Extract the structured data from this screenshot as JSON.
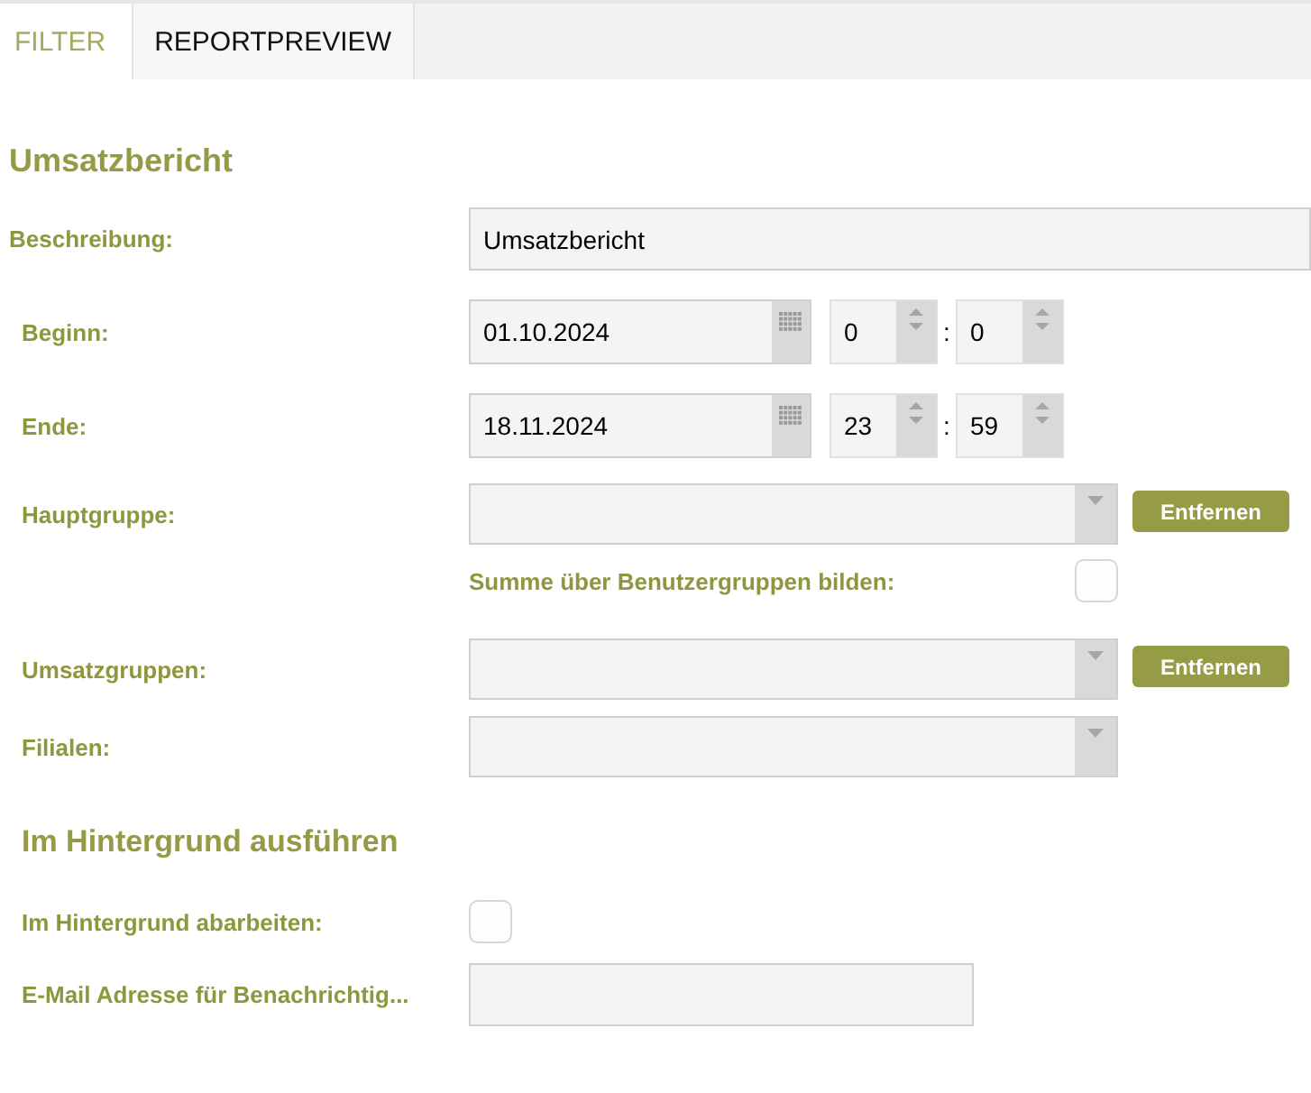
{
  "tabs": [
    {
      "label": "FILTER",
      "selected": true
    },
    {
      "label": "REPORTPREVIEW",
      "selected": false
    }
  ],
  "title": "Umsatzbericht",
  "description": {
    "label": "Beschreibung:",
    "value": "Umsatzbericht"
  },
  "periods": [
    {
      "label": "Beginn:",
      "date": "01.10.2024",
      "hour": "0",
      "minute": "0"
    },
    {
      "label": "Ende:",
      "date": "18.11.2024",
      "hour": "23",
      "minute": "59"
    }
  ],
  "time_separator": ":",
  "groups": [
    {
      "kind": "select",
      "label": "Hauptgruppe:",
      "button": "Entfernen"
    },
    {
      "kind": "checkbox",
      "label": "Summe über Benutzergruppen bilden:",
      "checked": false
    },
    {
      "kind": "select",
      "label": "Umsatzgruppen:",
      "button": "Entfernen"
    },
    {
      "kind": "select",
      "label": "Filialen:"
    }
  ],
  "background": {
    "title": "Im Hintergrund ausführen",
    "items": [
      {
        "kind": "checkbox",
        "label": "Im Hintergrund abarbeiten:",
        "checked": false
      },
      {
        "kind": "text",
        "label": "E-Mail Adresse für Benachrichtig..."
      }
    ]
  }
}
